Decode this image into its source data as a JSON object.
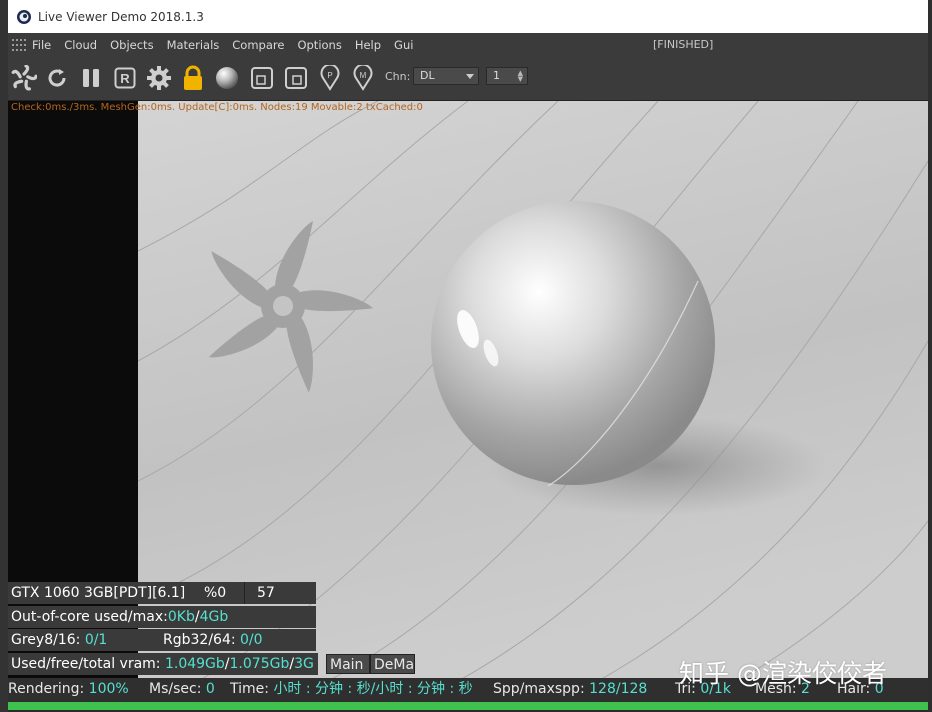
{
  "window": {
    "title": "Live Viewer Demo 2018.1.3"
  },
  "menu": {
    "items": [
      "File",
      "Cloud",
      "Objects",
      "Materials",
      "Compare",
      "Options",
      "Help",
      "Gui"
    ],
    "status": "[FINISHED]"
  },
  "toolbar": {
    "icons": [
      "octane-logo-icon",
      "restart-icon",
      "pause-icon",
      "region-render-icon",
      "settings-gear-icon",
      "lock-icon",
      "material-sphere-icon",
      "clay-mode-icon",
      "pick-focus-icon",
      "pick-material-icon",
      "pick-object-icon"
    ],
    "lock_color": "#f0b400",
    "chn_label": "Chn:",
    "chn_value": "DL",
    "spin_value": "1"
  },
  "viewport": {
    "debug": "Check:0ms./3ms. MeshGen:0ms. Update[C]:0ms. Nodes:19 Movable:2 txCached:0"
  },
  "gpu": {
    "name": "GTX 1060 3GB[PDT][6.1]",
    "percent": "%0",
    "temp": "57",
    "ooc_label": "Out-of-core used/max:",
    "ooc_used": "0Kb",
    "ooc_max": "4Gb",
    "grey_label": "Grey8/16: ",
    "grey_value": "0/1",
    "rgb_label": "Rgb32/64: ",
    "rgb_value": "0/0",
    "vram_label": "Used/free/total vram: ",
    "vram_used": "1.049Gb",
    "vram_free": "1.075Gb",
    "vram_total": "3G"
  },
  "tabs": [
    "Main",
    "DeMain"
  ],
  "status": {
    "rendering_label": "Rendering: ",
    "rendering_value": "100%",
    "mssec_label": "Ms/sec: ",
    "mssec_value": "0",
    "time_label": "Time: ",
    "time_value": "小时 : 分钟 : 秒/小时 : 分钟 : 秒",
    "spp_label": "Spp/maxspp: ",
    "spp_value": "128/128",
    "tri_label": "Tri: ",
    "tri_value": "0/1k",
    "mesh_label": "Mesh: ",
    "mesh_value": "2",
    "hair_label": "Hair: ",
    "hair_value": "0",
    "progress": 1.0
  },
  "watermark": "知乎 @渲染佼佼者"
}
